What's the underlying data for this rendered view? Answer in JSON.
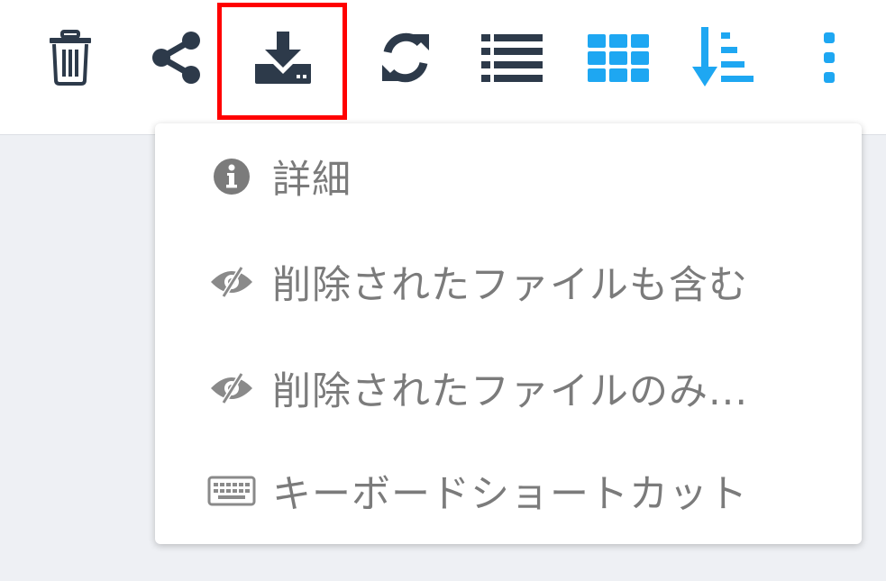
{
  "toolbar": {
    "buttons": [
      {
        "name": "delete",
        "icon": "trash-icon",
        "color": "#2d3a4a"
      },
      {
        "name": "share",
        "icon": "share-icon",
        "color": "#2d3a4a"
      },
      {
        "name": "download",
        "icon": "download-icon",
        "color": "#2d3a4a"
      },
      {
        "name": "refresh",
        "icon": "refresh-icon",
        "color": "#2d3a4a"
      },
      {
        "name": "list-view",
        "icon": "list-icon",
        "color": "#2d3a4a"
      },
      {
        "name": "grid-view",
        "icon": "grid-icon",
        "color": "#1ea7f2"
      },
      {
        "name": "sort",
        "icon": "sort-icon",
        "color": "#1ea7f2"
      },
      {
        "name": "more",
        "icon": "more-vertical-icon",
        "color": "#1ea7f2"
      }
    ],
    "highlight_color": "#ff0000"
  },
  "menu": {
    "items": [
      {
        "label": "詳細",
        "icon": "info-icon"
      },
      {
        "label": "削除されたファイルも含む",
        "icon": "eye-slash-icon"
      },
      {
        "label": "削除されたファイルのみ...",
        "icon": "eye-slash-icon"
      },
      {
        "label": "キーボードショートカット",
        "icon": "keyboard-icon"
      }
    ]
  }
}
